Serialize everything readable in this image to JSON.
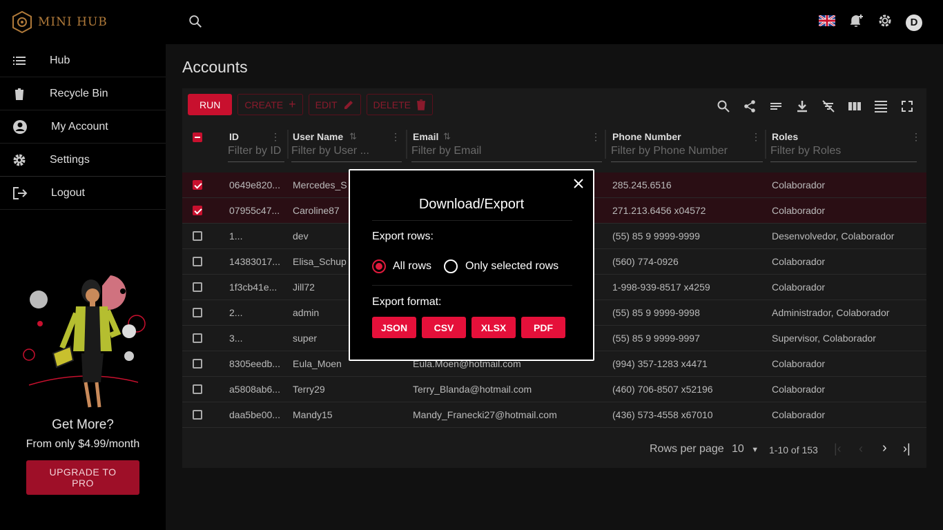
{
  "app": {
    "name": "MINI HUB"
  },
  "colors": {
    "accent": "#c8102e",
    "brand": "#b07a3a"
  },
  "sidebar": {
    "items": [
      {
        "label": "Hub",
        "icon": "list-icon"
      },
      {
        "label": "Recycle Bin",
        "icon": "trash-icon"
      },
      {
        "label": "My Account",
        "icon": "account-circle-icon"
      },
      {
        "label": "Settings",
        "icon": "gear-icon"
      },
      {
        "label": "Logout",
        "icon": "logout-icon"
      }
    ],
    "promo": {
      "title": "Get More?",
      "subtitle": "From only $4.99/month",
      "button": "UPGRADE TO PRO"
    }
  },
  "header": {
    "avatar_letter": "D"
  },
  "page": {
    "title": "Accounts"
  },
  "toolbar": {
    "run": "RUN",
    "create": "CREATE",
    "edit": "EDIT",
    "delete": "DELETE"
  },
  "table": {
    "columns": [
      {
        "label": "ID",
        "filter": "Filter by ID"
      },
      {
        "label": "User Name",
        "filter": "Filter by User ..."
      },
      {
        "label": "Email",
        "filter": "Filter by Email"
      },
      {
        "label": "Phone Number",
        "filter": "Filter by Phone Number"
      },
      {
        "label": "Roles",
        "filter": "Filter by Roles"
      }
    ],
    "rows": [
      {
        "id": "0649e820...",
        "user": "Mercedes_S",
        "email": "",
        "phone": "285.245.6516",
        "roles": "Colaborador",
        "selected": true
      },
      {
        "id": "07955c47...",
        "user": "Caroline87",
        "email": "",
        "phone": "271.213.6456 x04572",
        "roles": "Colaborador",
        "selected": true
      },
      {
        "id": "1...",
        "user": "dev",
        "email": "",
        "phone": "(55) 85 9 9999-9999",
        "roles": "Desenvolvedor, Colaborador",
        "selected": false
      },
      {
        "id": "14383017...",
        "user": "Elisa_Schup",
        "email": "",
        "phone": "(560) 774-0926",
        "roles": "Colaborador",
        "selected": false
      },
      {
        "id": "1f3cb41e...",
        "user": "Jill72",
        "email": "",
        "phone": "1-998-939-8517 x4259",
        "roles": "Colaborador",
        "selected": false
      },
      {
        "id": "2...",
        "user": "admin",
        "email": "",
        "phone": "(55) 85 9 9999-9998",
        "roles": "Administrador, Colaborador",
        "selected": false
      },
      {
        "id": "3...",
        "user": "super",
        "email": "",
        "phone": "(55) 85 9 9999-9997",
        "roles": "Supervisor, Colaborador",
        "selected": false
      },
      {
        "id": "8305eedb...",
        "user": "Eula_Moen",
        "email": "Eula.Moen@hotmail.com",
        "phone": "(994) 357-1283 x4471",
        "roles": "Colaborador",
        "selected": false
      },
      {
        "id": "a5808ab6...",
        "user": "Terry29",
        "email": "Terry_Blanda@hotmail.com",
        "phone": "(460) 706-8507 x52196",
        "roles": "Colaborador",
        "selected": false
      },
      {
        "id": "daa5be00...",
        "user": "Mandy15",
        "email": "Mandy_Franecki27@hotmail.com",
        "phone": "(436) 573-4558 x67010",
        "roles": "Colaborador",
        "selected": false
      }
    ]
  },
  "pagination": {
    "rows_per_page_label": "Rows per page",
    "rows_per_page": "10",
    "range": "1-10 of 153"
  },
  "modal": {
    "title": "Download/Export",
    "export_rows_label": "Export rows:",
    "option_all": "All rows",
    "option_selected": "Only selected rows",
    "selected_option": "All rows",
    "export_format_label": "Export format:",
    "formats": [
      "JSON",
      "CSV",
      "XLSX",
      "PDF"
    ]
  }
}
